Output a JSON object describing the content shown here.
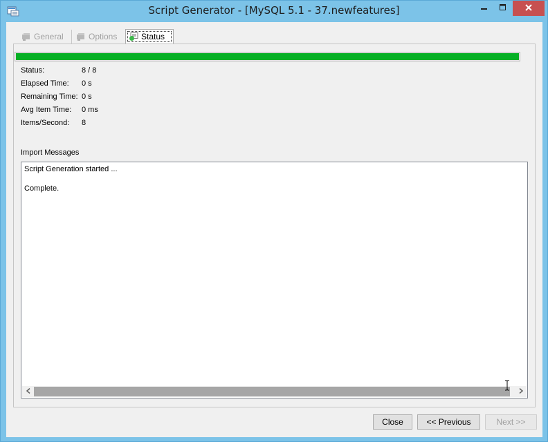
{
  "window": {
    "title": "Script Generator - [MySQL 5.1 - 37.newfeatures]"
  },
  "tabs": [
    {
      "label": "General",
      "active": false,
      "enabled": false
    },
    {
      "label": "Options",
      "active": false,
      "enabled": false
    },
    {
      "label": "Status",
      "active": true,
      "enabled": true
    }
  ],
  "progress": {
    "fraction": 1.0,
    "color": "#06b025"
  },
  "stats": [
    {
      "label": "Status:",
      "value": "8 / 8"
    },
    {
      "label": "Elapsed Time:",
      "value": "0 s"
    },
    {
      "label": "Remaining Time:",
      "value": "0 s"
    },
    {
      "label": "Avg Item Time:",
      "value": "0 ms"
    },
    {
      "label": "Items/Second:",
      "value": "8"
    }
  ],
  "messages": {
    "heading": "Import Messages",
    "lines": [
      "Script Generation started ...",
      "Complete."
    ]
  },
  "buttons": {
    "close": "Close",
    "previous": "<< Previous",
    "next": "Next >>"
  },
  "icons": {
    "app": "script-generator-icon",
    "minimize": "minimize-icon",
    "maximize": "maximize-icon",
    "close": "close-icon"
  },
  "colors": {
    "titlebar": "#7cc3e8",
    "close_button": "#c75050",
    "progress": "#06b025"
  }
}
